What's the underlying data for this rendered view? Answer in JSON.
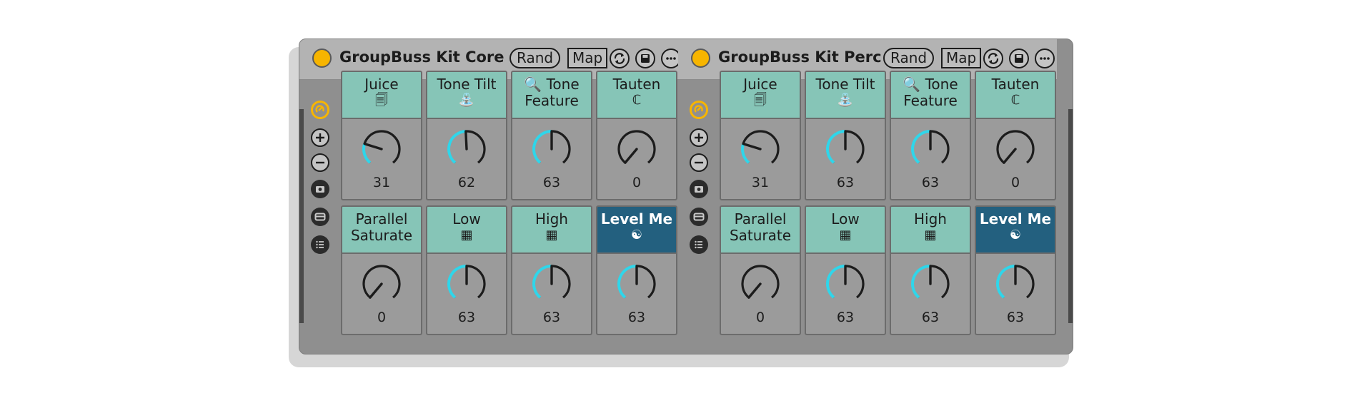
{
  "racks": [
    {
      "title": "GroupBuss Kit Core",
      "rand_label": "Rand",
      "map_label": "Map",
      "cells": [
        {
          "line1": "Juice",
          "line2": "",
          "icon": "🗐",
          "icon_name": "juice-icon",
          "value": "31",
          "fraction": 0.24,
          "active": false
        },
        {
          "line1": "Tone Tilt",
          "line2": "",
          "icon": "⛲",
          "icon_name": "tilt-icon",
          "value": "62",
          "fraction": 0.49,
          "active": false
        },
        {
          "line1": "🔍 Tone",
          "line2": "Feature",
          "icon": "",
          "icon_name": "magnifier-icon",
          "value": "63",
          "fraction": 0.5,
          "active": false
        },
        {
          "line1": "Tauten",
          "line2": "",
          "icon": "ℂ",
          "icon_name": "clamp-icon",
          "value": "0",
          "fraction": 0.0,
          "active": false
        },
        {
          "line1": "Parallel",
          "line2": "Saturate",
          "icon": "",
          "icon_name": "",
          "value": "0",
          "fraction": 0.0,
          "active": false
        },
        {
          "line1": "Low",
          "line2": "",
          "icon": "▦",
          "icon_name": "low-graph-icon",
          "value": "63",
          "fraction": 0.5,
          "active": false
        },
        {
          "line1": "High",
          "line2": "",
          "icon": "▦",
          "icon_name": "high-graph-icon",
          "value": "63",
          "fraction": 0.5,
          "active": false
        },
        {
          "line1": "Level Me",
          "line2": "",
          "icon": "☯",
          "icon_name": "yin-yang-icon",
          "value": "63",
          "fraction": 0.5,
          "active": true
        }
      ]
    },
    {
      "title": "GroupBuss Kit Perc",
      "rand_label": "Rand",
      "map_label": "Map",
      "cells": [
        {
          "line1": "Juice",
          "line2": "",
          "icon": "🗐",
          "icon_name": "juice-icon",
          "value": "31",
          "fraction": 0.24,
          "active": false
        },
        {
          "line1": "Tone Tilt",
          "line2": "",
          "icon": "⛲",
          "icon_name": "tilt-icon",
          "value": "63",
          "fraction": 0.5,
          "active": false
        },
        {
          "line1": "🔍 Tone",
          "line2": "Feature",
          "icon": "",
          "icon_name": "magnifier-icon",
          "value": "63",
          "fraction": 0.5,
          "active": false
        },
        {
          "line1": "Tauten",
          "line2": "",
          "icon": "ℂ",
          "icon_name": "clamp-icon",
          "value": "0",
          "fraction": 0.0,
          "active": false
        },
        {
          "line1": "Parallel",
          "line2": "Saturate",
          "icon": "",
          "icon_name": "",
          "value": "0",
          "fraction": 0.0,
          "active": false
        },
        {
          "line1": "Low",
          "line2": "",
          "icon": "▦",
          "icon_name": "low-graph-icon",
          "value": "63",
          "fraction": 0.5,
          "active": false
        },
        {
          "line1": "High",
          "line2": "",
          "icon": "▦",
          "icon_name": "high-graph-icon",
          "value": "63",
          "fraction": 0.5,
          "active": false
        },
        {
          "line1": "Level Me",
          "line2": "",
          "icon": "☯",
          "icon_name": "yin-yang-icon",
          "value": "63",
          "fraction": 0.5,
          "active": true
        }
      ]
    }
  ],
  "colors": {
    "power": "#f7b500",
    "label_bg": "#86c5b7",
    "label_active_bg": "#23607f",
    "arc": "#2fd6ea",
    "knob_ring": "#1c1c1c"
  }
}
